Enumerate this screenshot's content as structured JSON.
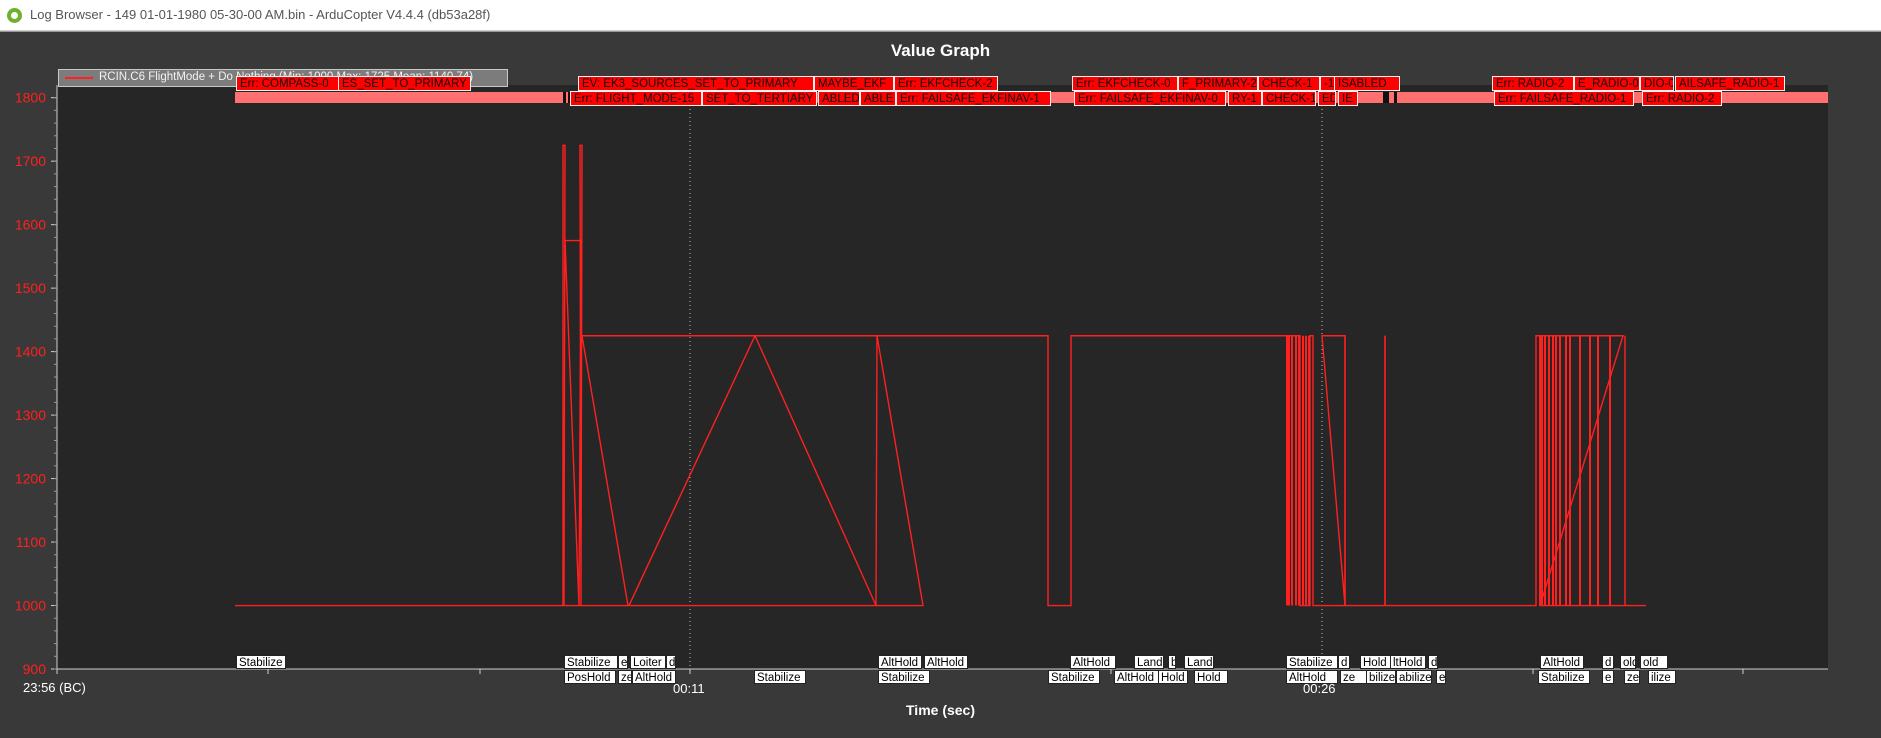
{
  "window": {
    "title": "Log Browser - 149 01-01-1980 05-30-00 AM.bin - ArduCopter V4.4.4 (db53a28f)"
  },
  "graph": {
    "title": "Value Graph",
    "x_axis_title": "Time (sec)",
    "x_tick_labels": [
      "23:56 (BC)",
      "00:11",
      "00:26"
    ],
    "legend_text": "RCIN.C6 FlightMode + Do Nothing (Min: 1000 Max: 1725 Mean: 1140.74)"
  },
  "colors": {
    "series": "#ff2020",
    "error_band": "#ff7070",
    "error_label": "#ff0000",
    "plot_bg": "#262626"
  },
  "events_top": {
    "row1": [
      "Err: COMPASS-0",
      "ES_SET_TO_PRIMARY",
      "EV: EK3_SOURCES_SET_TO_PRIMARY",
      "MAYBE_EKF",
      "Err: EKFCHECK-2",
      "Err: EKFCHECK-0",
      "F_PRIMARY-2",
      "CHECK-1",
      "-1",
      "ISABLED",
      "Err: RADIO-2",
      "E_RADIO-0",
      "DIO-0",
      "AILSAFE_RADIO-1"
    ],
    "row2": [
      "Err: FLIGHT_MODE-15",
      "SET_TO_TERTIARY",
      "ABLED",
      "ABLE",
      "Err: FAILSAFE_EKFINAV-1",
      "Err: FAILSAFE_EKFINAV-0",
      "RY-1",
      "CHECK-1",
      "ED",
      "IE",
      "Err: FAILSAFE_RADIO-1",
      "Err: RADIO-2"
    ]
  },
  "modes_bottom": {
    "row1": [
      "Stabilize",
      "Stabilize",
      "e",
      "Loiter",
      "d",
      "AltHold",
      "AltHold",
      "AltHold",
      "Land",
      "b",
      "Land",
      "Stabilize",
      "d",
      "Hold",
      "ltHold",
      "d",
      "AltHold",
      "d",
      "old",
      "old"
    ],
    "row2": [
      "PosHold",
      "ze",
      "AltHold",
      "Stabilize",
      "Stabilize",
      "Stabilize",
      "AltHold",
      "Hold",
      "Hold",
      "AltHold",
      "ze",
      "bilize",
      "abilize",
      "e",
      "Stabilize",
      "e",
      "ze",
      "ilize"
    ]
  },
  "chart_data": {
    "type": "line",
    "title": "Value Graph",
    "xlabel": "Time (sec)",
    "ylabel": "",
    "ylim": [
      900,
      1820
    ],
    "yticks": [
      900,
      1000,
      1100,
      1200,
      1300,
      1400,
      1500,
      1600,
      1700,
      1800
    ],
    "series": [
      {
        "name": "RCIN.C6 FlightMode + Do Nothing (Min: 1000 Max: 1725 Mean: 1140.74)",
        "values": [
          1000,
          1725,
          1000,
          1575,
          1000,
          1725,
          1000,
          1425,
          1425,
          1000,
          1000,
          1425,
          1000,
          1425,
          1425,
          1000,
          1425,
          1425,
          1000,
          1425,
          1000,
          1425,
          1000,
          1425,
          1000,
          1425,
          1000,
          1000
        ]
      }
    ],
    "grid": false
  }
}
